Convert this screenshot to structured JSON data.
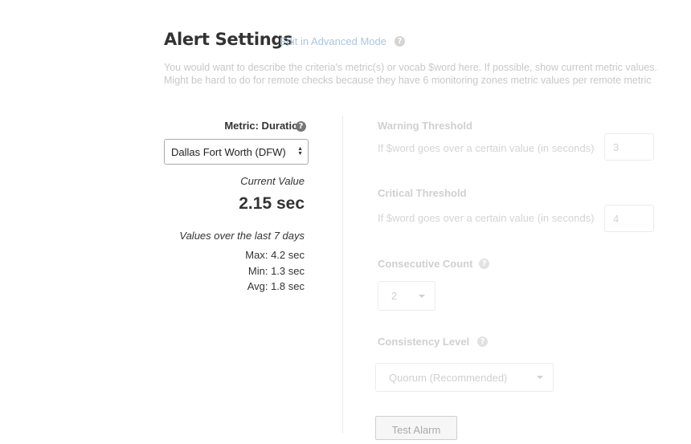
{
  "header": {
    "title": "Alert Settings",
    "edit_link": "Edit in Advanced Mode",
    "description_line1": "You would want to describe the criteria's metric(s) or vocab $word here. If possible, show current metric values.",
    "description_line2": "Might be hard to do for remote checks because they have 6 monitoring zones metric values per remote metric"
  },
  "metric": {
    "label": "Metric: Duration",
    "location_selected": "Dallas Fort Worth (DFW)",
    "current_label": "Current Value",
    "current_value": "2.15 sec",
    "history_label": "Values over the last 7 days",
    "max": "Max: 4.2 sec",
    "min": "Min: 1.3 sec",
    "avg": "Avg: 1.8 sec"
  },
  "warning": {
    "label": "Warning Threshold",
    "hint": "If $word goes over a certain value (in seconds)",
    "value": "3"
  },
  "critical": {
    "label": "Critical Threshold",
    "hint": "If $word goes over a certain value (in seconds)",
    "value": "4"
  },
  "consecutive": {
    "label": "Consecutive Count",
    "value": "2"
  },
  "consistency": {
    "label": "Consistency Level",
    "value": "Quorum (Recommended)"
  },
  "actions": {
    "test_alarm": "Test Alarm"
  },
  "icons": {
    "help": "?"
  },
  "colors": {
    "link": "#a9c6e0",
    "disabled_text": "#d0d0d0"
  }
}
